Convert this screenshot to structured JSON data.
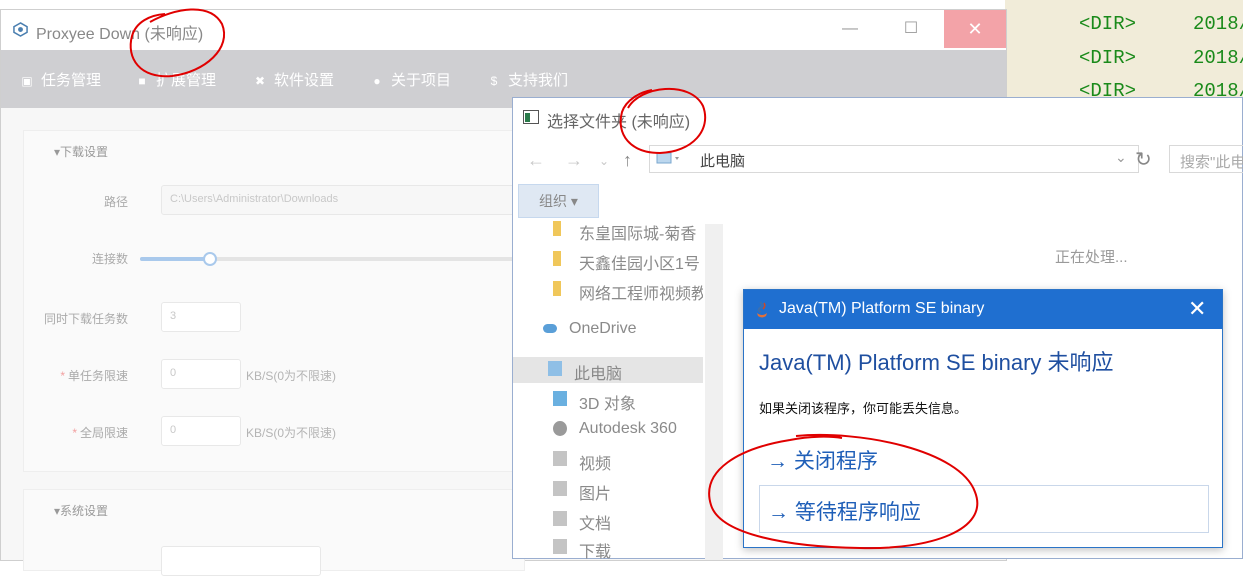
{
  "background_listing": {
    "rows": [
      {
        "type": "<DIR>",
        "date": "2018/"
      },
      {
        "type": "<DIR>",
        "date": "2018/"
      },
      {
        "type": "<DIR>",
        "date": "2018/"
      }
    ]
  },
  "proxyee": {
    "title": "Proxyee Down (未响应)",
    "menu": [
      {
        "label": "任务管理",
        "icon": "▣"
      },
      {
        "label": "扩展管理",
        "icon": "■"
      },
      {
        "label": "软件设置",
        "icon": "✖"
      },
      {
        "label": "关于项目",
        "icon": "●"
      },
      {
        "label": "支持我们",
        "icon": "$"
      }
    ],
    "download_section": "▾下载设置",
    "fields": {
      "path_label": "路径",
      "path_value": "C:\\Users\\Administrator\\Downloads",
      "connections_label": "连接数",
      "concurrent_label": "同时下载任务数",
      "concurrent_value": "3",
      "single_limit_label": "单任务限速",
      "single_limit_value": "0",
      "single_limit_hint": "KB/S(0为不限速)",
      "global_limit_label": "全局限速",
      "global_limit_value": "0",
      "global_limit_hint": "KB/S(0为不限速)",
      "required_mark": "*"
    },
    "system_section": "▾系统设置",
    "connections_slider_level": 0.18
  },
  "chooser": {
    "title": "选择文件夹 (未响应)",
    "address": "此电脑",
    "search_placeholder": "搜索\"此电",
    "organize_label": "组织 ▾",
    "tree": [
      {
        "label": "东皇国际城-菊香",
        "icon": "folder"
      },
      {
        "label": "天鑫佳园小区1号",
        "icon": "folder"
      },
      {
        "label": "网络工程师视频教",
        "icon": "folder"
      },
      {
        "label": "OneDrive",
        "icon": "cloud"
      },
      {
        "label": "此电脑",
        "icon": "computer"
      },
      {
        "label": "3D 对象",
        "icon": "3d"
      },
      {
        "label": "Autodesk 360",
        "icon": "autodesk"
      },
      {
        "label": "视频",
        "icon": "video"
      },
      {
        "label": "图片",
        "icon": "picture"
      },
      {
        "label": "文档",
        "icon": "document"
      },
      {
        "label": "下载",
        "icon": "download"
      }
    ],
    "processing": "正在处理..."
  },
  "dialog": {
    "title": "Java(TM) Platform SE binary",
    "heading": "Java(TM) Platform SE binary 未响应",
    "info": "如果关闭该程序，你可能丢失信息。",
    "close_program": "→ 关闭程序",
    "wait_program": "→ 等待程序响应"
  },
  "colors": {
    "dialog_blue": "#1f6fd0",
    "annotation_red": "#e00000",
    "listing_green": "#1a8a1a"
  }
}
